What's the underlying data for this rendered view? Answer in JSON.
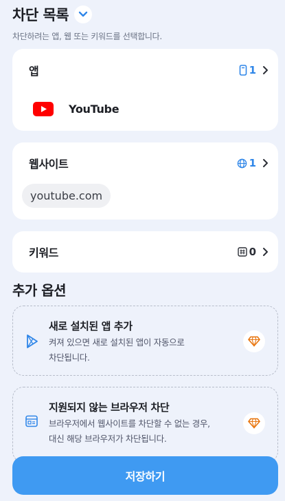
{
  "header": {
    "title": "차단 목록",
    "subtitle": "차단하려는 앱, 웹 또는 키워드를 선택합니다."
  },
  "apps": {
    "title": "앱",
    "count": "1",
    "items": [
      {
        "name": "YouTube"
      }
    ]
  },
  "websites": {
    "title": "웹사이트",
    "count": "1",
    "items": [
      {
        "url": "youtube.com"
      }
    ]
  },
  "keywords": {
    "title": "키워드",
    "count": "0"
  },
  "options": {
    "title": "추가 옵션",
    "items": [
      {
        "title": "새로 설치된 앱 추가",
        "desc_line1": "켜져 있으면 새로 설치된 앱이 자동으로",
        "desc_line2": "차단됩니다."
      },
      {
        "title": "지원되지 않는 브라우저 차단",
        "desc_line1": "브라우저에서 웹사이트를 차단할 수 없는 경우,",
        "desc_line2": "대신 해당 브라우저가 차단됩니다."
      }
    ]
  },
  "save_button": {
    "label": "저장하기"
  },
  "colors": {
    "accent": "#2f86e8",
    "button": "#3f9af2",
    "premium": "#e8740c",
    "youtube": "#ff0000"
  }
}
